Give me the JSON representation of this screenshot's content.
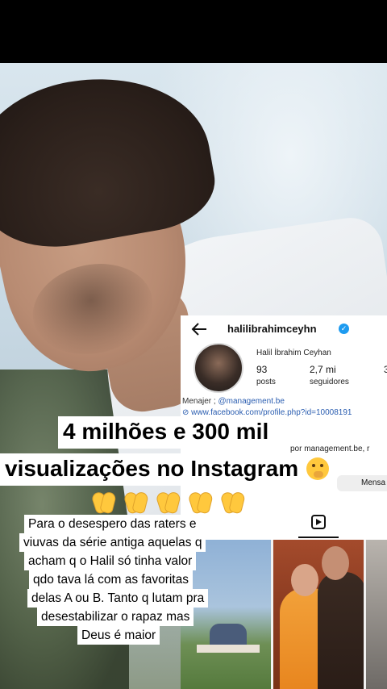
{
  "instagram": {
    "handle": "halilibrahimceyhn",
    "verified_icon": "check-badge-icon",
    "display_name": "Halil İbrahim Ceyhan",
    "stats": [
      {
        "value": "93",
        "label": "posts"
      },
      {
        "value": "2,7 mi",
        "label": "seguidores"
      },
      {
        "value": "3",
        "label": ""
      }
    ],
    "bio_prefix": "Menajer ; ",
    "bio_mention": "@management.be",
    "link": "www.facebook.com/profile.php?id=10008191",
    "by_line": "por management.be, r",
    "message_button": "Mensa",
    "reels_tab_icon": "reels-icon"
  },
  "caption": {
    "line1": "4 milhões e 300 mil",
    "line2": "visualizações no Instagram",
    "line2_emoji": "face-with-hand-over-mouth-emoji",
    "claps": [
      "clapping-hands-emoji",
      "clapping-hands-emoji",
      "clapping-hands-emoji",
      "clapping-hands-emoji",
      "clapping-hands-emoji"
    ]
  },
  "paragraph": [
    "Para o desespero das raters e",
    "viuvas da série antiga aquelas q",
    "acham q o Halil só tinha valor",
    "qdo tava lá com as favoritas",
    "delas A ou B. Tanto q lutam pra",
    "desestabilizar o rapaz mas",
    "Deus é maior"
  ]
}
